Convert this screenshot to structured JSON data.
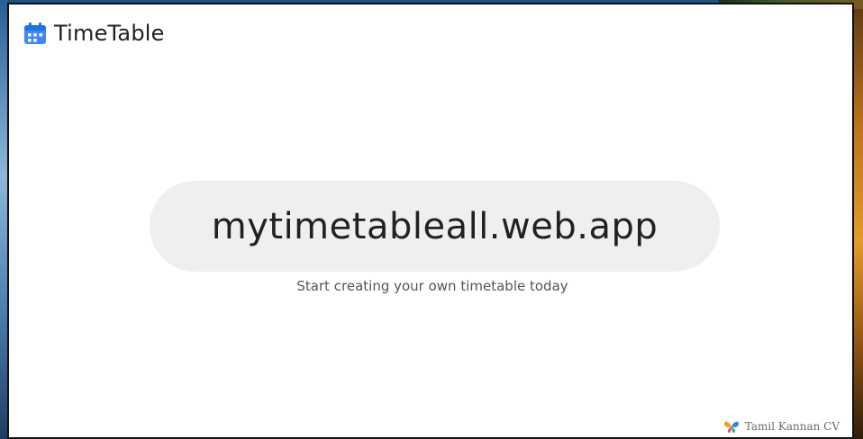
{
  "app": {
    "title": "TimeTable",
    "icon": "calendar-icon",
    "accent_color": "#4285f4"
  },
  "main": {
    "url": "mytimetableall.web.app",
    "tagline": "Start creating your own timetable today"
  },
  "footer": {
    "credit": "Tamil Kannan CV",
    "icon": "butterfly-logo-icon"
  }
}
